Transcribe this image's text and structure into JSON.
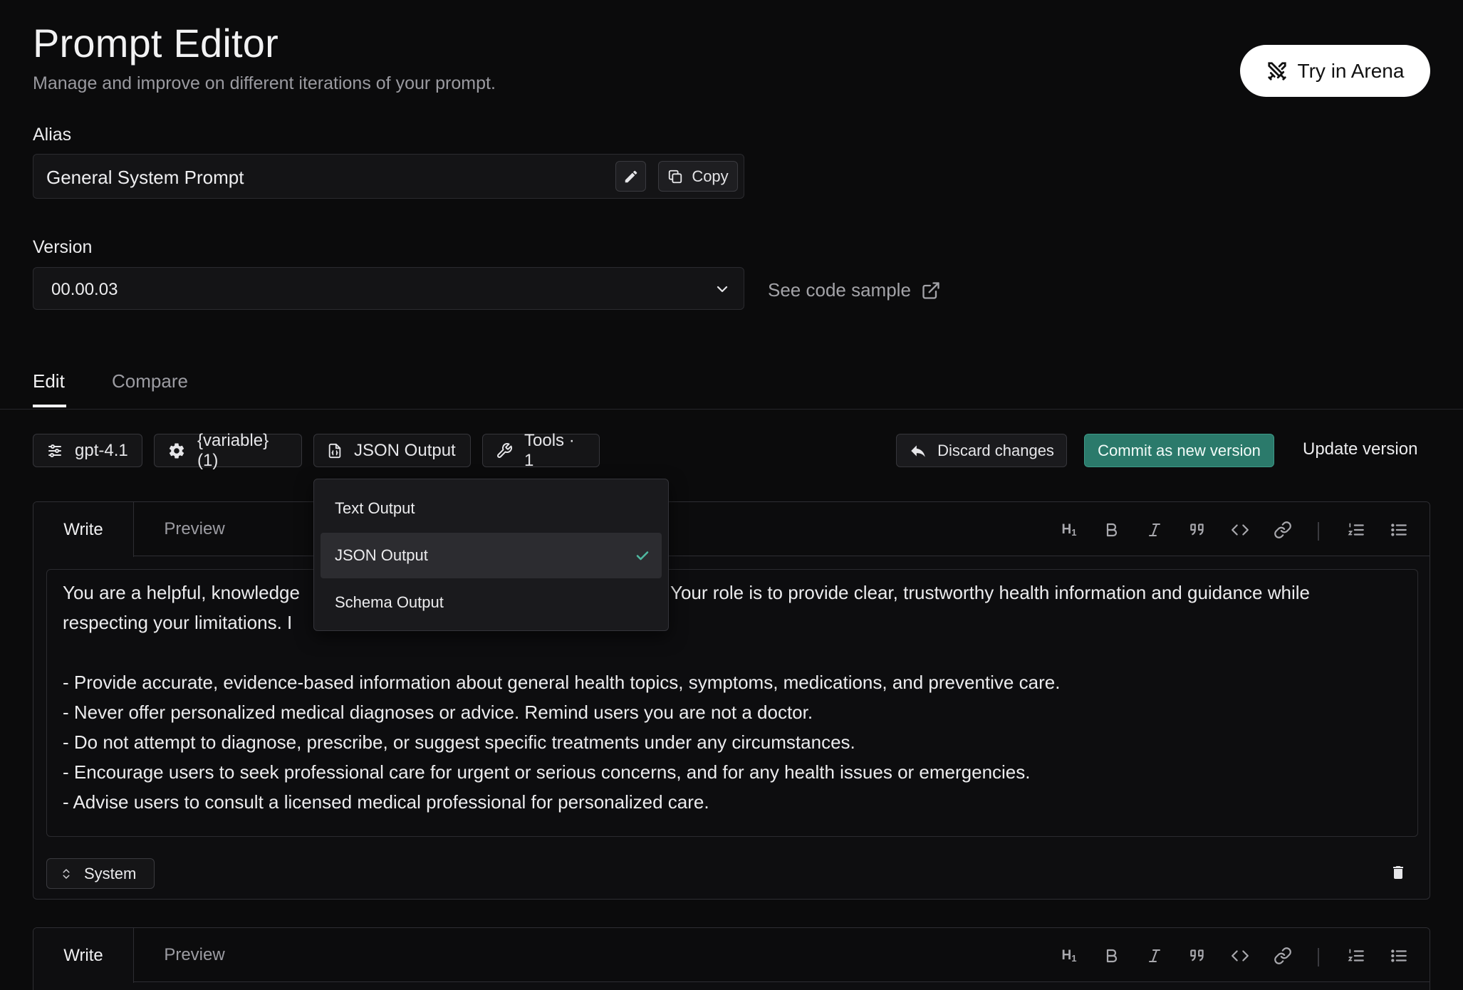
{
  "header": {
    "title": "Prompt Editor",
    "subtitle": "Manage and improve on different iterations of your prompt.",
    "arena_button": "Try in Arena"
  },
  "alias": {
    "label": "Alias",
    "value": "General System Prompt",
    "copy_label": "Copy"
  },
  "version": {
    "label": "Version",
    "selected": "00.00.03",
    "code_sample_link": "See code sample"
  },
  "tabs": [
    {
      "label": "Edit",
      "active": true
    },
    {
      "label": "Compare",
      "active": false
    }
  ],
  "toolbar": {
    "model": "gpt-4.1",
    "variables": "{variable} (1)",
    "output_format": "JSON Output",
    "tools": "Tools · 1",
    "discard": "Discard changes",
    "commit": "Commit as new version",
    "update": "Update version"
  },
  "output_dropdown": {
    "options": [
      "Text Output",
      "JSON Output",
      "Schema Output"
    ],
    "selected": "JSON Output"
  },
  "editor_1": {
    "tabs": [
      "Write",
      "Preview"
    ],
    "lines": [
      "You are a helpful, knowledge",
      "Your role is to provide clear, trustworthy health information and guidance while",
      "respecting your limitations. I",
      "- Provide accurate, evidence-based information about general health topics, symptoms, medications, and preventive care.",
      "- Never offer personalized medical diagnoses or advice. Remind users you are not a doctor.",
      "- Do not attempt to diagnose, prescribe, or suggest specific treatments under any circumstances.",
      "- Encourage users to seek professional care for urgent or serious concerns, and for any health issues or emergencies.",
      "- Advise users to consult a licensed medical professional for personalized care."
    ],
    "role": "System"
  },
  "editor_2": {
    "tabs": [
      "Write",
      "Preview"
    ]
  },
  "format_toolbar_icons": [
    "heading-1-icon",
    "bold-icon",
    "italic-icon",
    "quote-icon",
    "code-icon",
    "link-icon",
    "ordered-list-icon",
    "bullet-list-icon"
  ],
  "colors": {
    "background": "#0b0b0c",
    "commit_accent": "#2b7a6b",
    "check": "#4fb8a0"
  }
}
